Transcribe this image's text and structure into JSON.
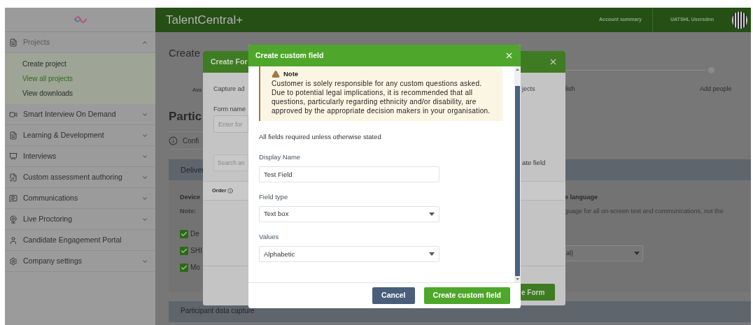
{
  "sidebar": {
    "items": [
      {
        "kind": "group",
        "label": "Projects",
        "expanded": true,
        "children": [
          {
            "label": "Create project",
            "selected": false
          },
          {
            "label": "View all projects",
            "selected": true
          },
          {
            "label": "View downloads",
            "selected": false
          }
        ]
      },
      {
        "kind": "group",
        "label": "Smart Interview On Demand",
        "expanded": false
      },
      {
        "kind": "group",
        "label": "Learning & Development",
        "expanded": false
      },
      {
        "kind": "group",
        "label": "Interviews",
        "expanded": false
      },
      {
        "kind": "group",
        "label": "Custom assessment authoring",
        "expanded": false
      },
      {
        "kind": "group",
        "label": "Communications",
        "expanded": false
      },
      {
        "kind": "group",
        "label": "Live Proctoring",
        "expanded": false
      },
      {
        "kind": "link",
        "label": "Candidate Engagement Portal"
      },
      {
        "kind": "group",
        "label": "Company settings",
        "expanded": false
      }
    ]
  },
  "header": {
    "app_title": "TalentCentral+",
    "account_link": "Account summary",
    "user_name": "UATSHL Usersdnn"
  },
  "page": {
    "title": "Create",
    "steps": [
      {
        "label": "Ass"
      },
      {
        "label": "lish"
      },
      {
        "label": "Add people"
      }
    ],
    "section_title": "Partic",
    "info": "Confi",
    "delivery_panel": {
      "title": "Deliver",
      "devices_title": "Device",
      "note_label": "Note:",
      "options": [
        {
          "label": "De",
          "checked": true
        },
        {
          "label": "SHI",
          "checked": true
        },
        {
          "label": "Mo",
          "checked": true
        }
      ],
      "language_title": "e language",
      "language_text": "guage for all on-screen text and communications, not the",
      "language_value": "al)"
    },
    "data_capture_panel": {
      "title": "Participant data capture"
    }
  },
  "create_form_modal": {
    "title": "Create For",
    "description": "Capture ad",
    "description_end": "jects",
    "form_name_label": "Form name",
    "form_name_placeholder": "Enter for",
    "search_placeholder": "Search an",
    "create_field_link": "ate field",
    "order_label": "Order",
    "submit_button": "e Form"
  },
  "custom_field_modal": {
    "title": "Create custom field",
    "note": {
      "title": "Note",
      "text": "Customer is solely responsible for any custom questions asked. Due to potential legal implications, it is recommended that all questions, particularly regarding ethnicity and/or disability, are approved by the appropriate decision makers in your organisation."
    },
    "required_hint": "All fields required unless otherwise stated",
    "fields": [
      {
        "kind": "text",
        "label": "Display Name",
        "value": "Test Field"
      },
      {
        "kind": "select",
        "label": "Field type",
        "value": "Text box"
      },
      {
        "kind": "select",
        "label": "Values",
        "value": "Alphabetic"
      }
    ],
    "buttons": [
      {
        "kind": "secondary",
        "label": "Cancel"
      },
      {
        "kind": "primary",
        "label": "Create custom field"
      }
    ]
  }
}
